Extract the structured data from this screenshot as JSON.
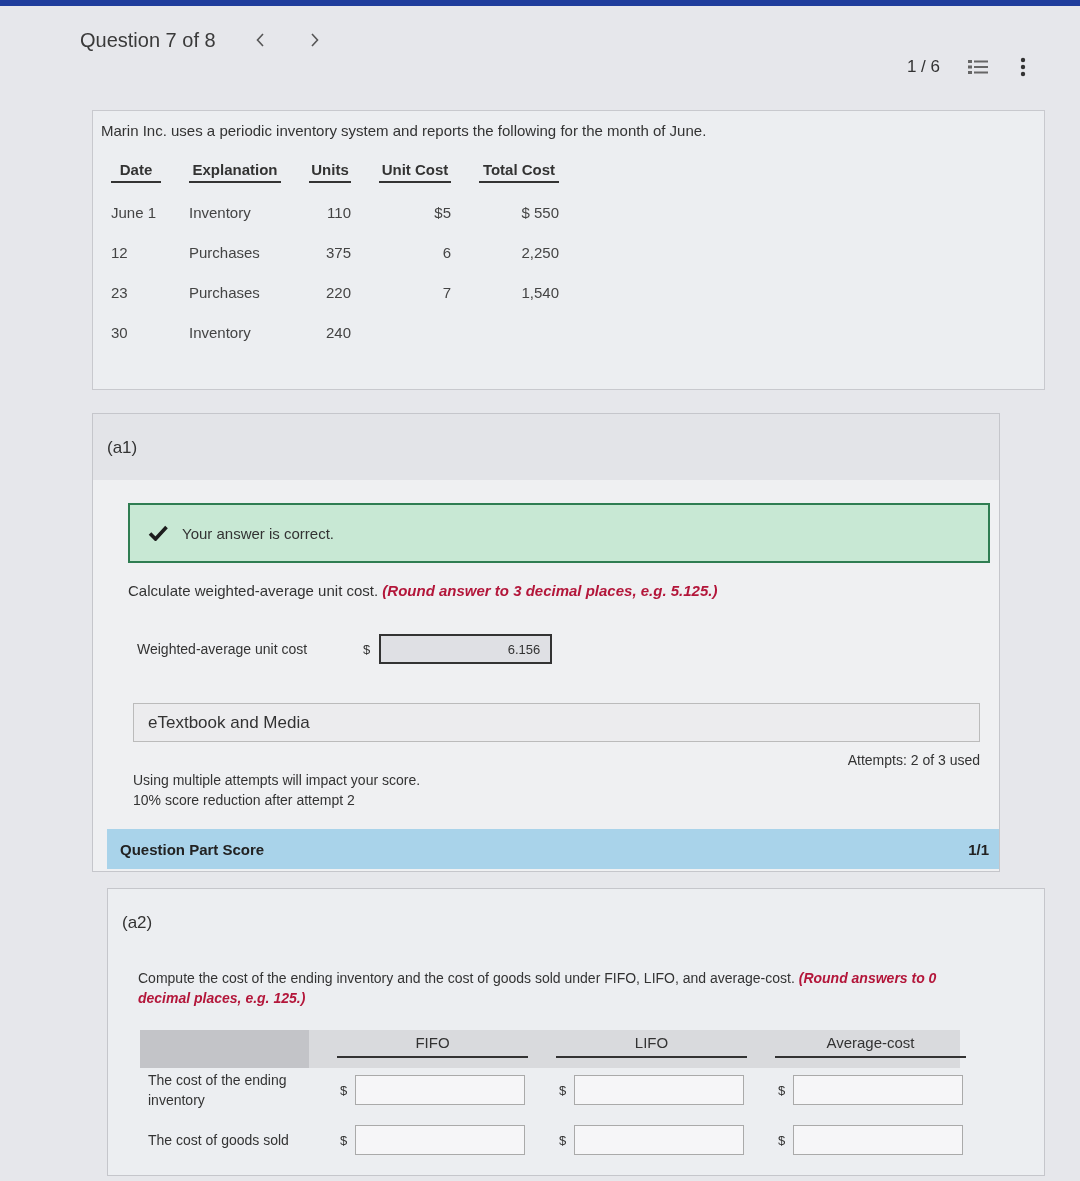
{
  "header": {
    "question": "Question 7 of 8",
    "page": "1 / 6"
  },
  "problem": {
    "intro": "Marin Inc. uses a periodic inventory system and reports the following for the month of June.",
    "table": {
      "columns": [
        "Date",
        "Explanation",
        "Units",
        "Unit Cost",
        "Total Cost"
      ],
      "rows": [
        [
          "June 1",
          "Inventory",
          "110",
          "$5",
          "$ 550"
        ],
        [
          "12",
          "Purchases",
          "375",
          "6",
          "2,250"
        ],
        [
          "23",
          "Purchases",
          "220",
          "7",
          "1,540"
        ],
        [
          "30",
          "Inventory",
          "240"
        ]
      ]
    }
  },
  "parts": [
    {
      "kind": "single",
      "label": "(a1)",
      "feedback": {
        "correct": true,
        "text": "Your answer is correct."
      },
      "instruction": "Calculate weighted-average unit cost.",
      "hint": "(Round answer to 3 decimal places, e.g. 5.125.)",
      "field": {
        "label": "Weighted-average unit cost",
        "currency": "$",
        "value": "6.156"
      },
      "resources": "eTextbook and Media",
      "attempts": "Attempts: 2 of 3 used",
      "notice": [
        "Using multiple attempts will impact your score.",
        "10% score reduction after attempt 2"
      ],
      "score": {
        "label": "Question Part Score",
        "value": "1/1"
      }
    },
    {
      "kind": "grid",
      "label": "(a2)",
      "instruction": "Compute the cost of the ending inventory and the cost of goods sold under FIFO, LIFO, and average-cost.",
      "hint": "(Round answers to 0 decimal places, e.g. 125.)",
      "grid": {
        "columns": [
          "FIFO",
          "LIFO",
          "Average-cost"
        ],
        "rows": [
          {
            "label": "The cost of the ending inventory",
            "cells": [
              {
                "currency": "$"
              },
              {
                "currency": "$"
              },
              {
                "currency": "$"
              }
            ]
          },
          {
            "label": "The cost of goods sold",
            "cells": [
              {
                "currency": "$"
              },
              {
                "currency": "$"
              },
              {
                "currency": "$"
              }
            ]
          }
        ]
      }
    }
  ]
}
